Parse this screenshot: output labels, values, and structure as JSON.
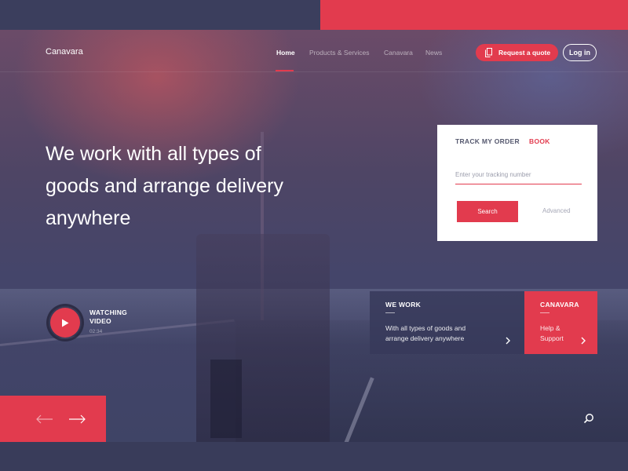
{
  "brand": {
    "name": "Canavara",
    "accent": "#e23b4e"
  },
  "nav": {
    "items": [
      {
        "label": "Home",
        "active": true
      },
      {
        "label": "Products & Services",
        "active": false
      },
      {
        "label": "Canavara",
        "active": false
      },
      {
        "label": "News",
        "active": false
      }
    ],
    "quote_button": "Request a quote",
    "login_button": "Log in"
  },
  "hero": {
    "headline": "We work with all types of goods and arrange delivery anywhere"
  },
  "track": {
    "tab_track": "TRACK MY ORDER",
    "tab_book": "BOOK",
    "input_placeholder": "Enter your tracking number",
    "search_button": "Search",
    "advanced_link": "Advanced"
  },
  "video": {
    "label": "WATCHING VIDEO",
    "duration": "02:34"
  },
  "cards": [
    {
      "title": "WE WORK",
      "text": "With all types of goods and arrange delivery anywhere"
    },
    {
      "title": "CANAVARA",
      "text": "Help & Support"
    }
  ],
  "icons": [
    "doc-icon",
    "play-icon",
    "chevron-right-icon",
    "arrow-left-icon",
    "arrow-right-icon",
    "search-icon"
  ]
}
